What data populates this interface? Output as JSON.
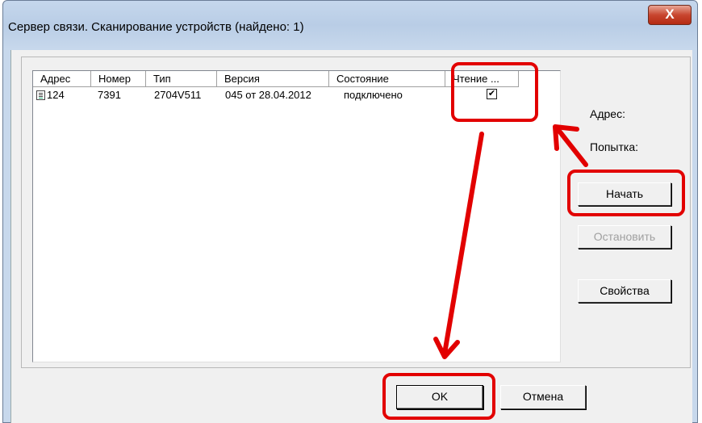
{
  "window": {
    "title": "Сервер связи. Сканирование устройств (найдено: 1)",
    "close_label": "X"
  },
  "list": {
    "columns": [
      "Адрес",
      "Номер",
      "Тип",
      "Версия",
      "Состояние",
      "Чтение ..."
    ],
    "rows": [
      {
        "address": "124",
        "number": "7391",
        "type": "2704V511",
        "version": "045 от 28.04.2012",
        "status": "подключено",
        "reading_checked": true
      }
    ]
  },
  "side": {
    "address_label": "Адрес:",
    "attempt_label": "Попытка:",
    "start_button": "Начать",
    "stop_button": "Остановить",
    "properties_button": "Свойства"
  },
  "footer": {
    "ok_button": "OK",
    "cancel_button": "Отмена"
  },
  "colors": {
    "annotation": "#e20000"
  },
  "icons": {
    "device_row": "device-table-icon",
    "check": "checkmark-icon"
  }
}
